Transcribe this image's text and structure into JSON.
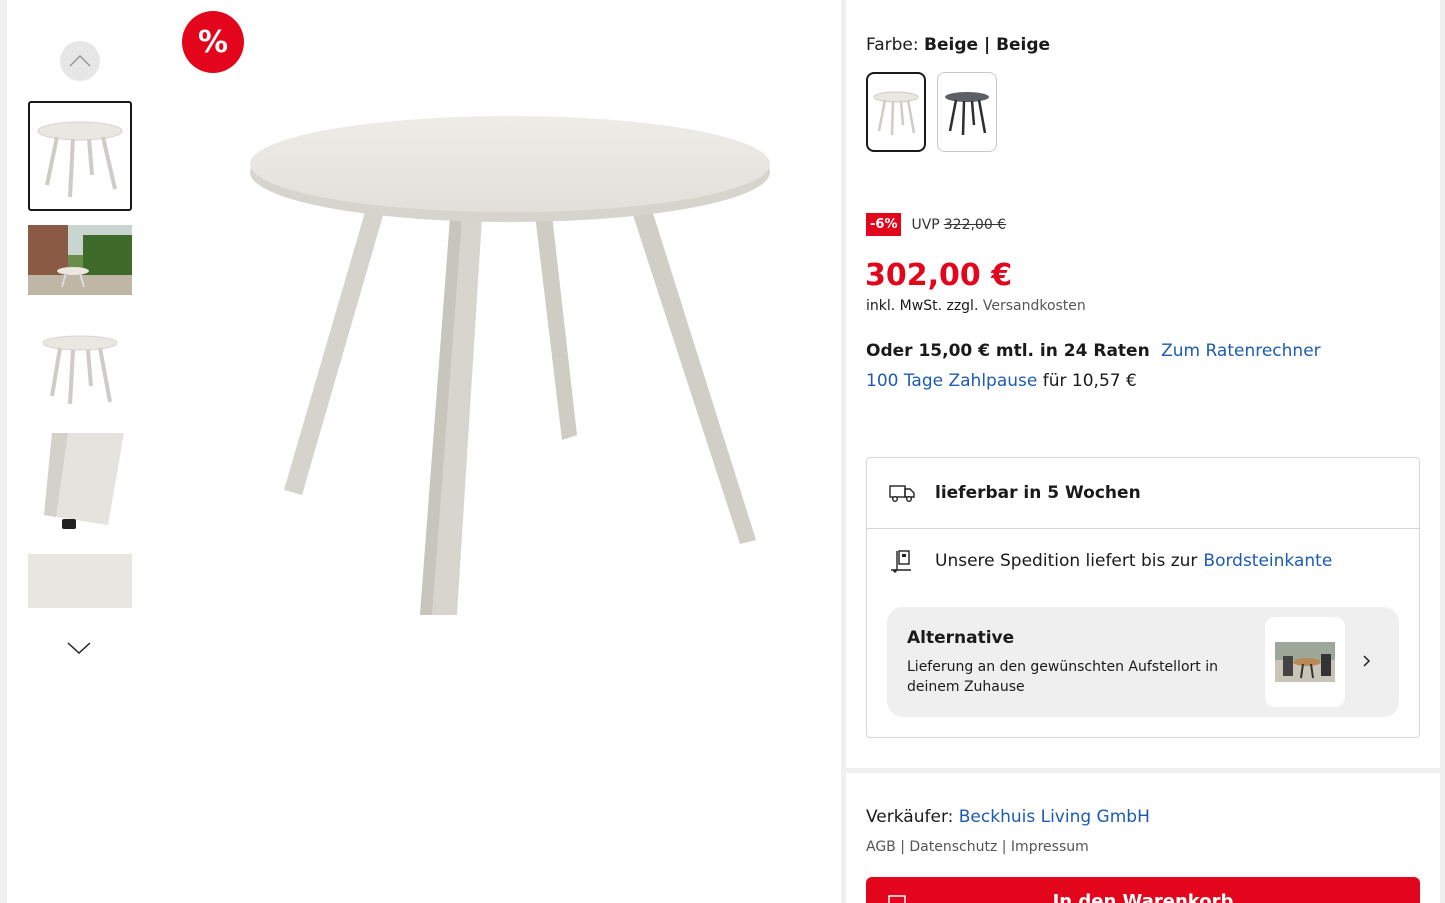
{
  "gallery": {
    "sale_badge": "%",
    "thumbnails": [
      "table-beige-thumb",
      "garden-scene-thumb",
      "table-small-thumb",
      "table-leg-detail-thumb",
      "beige-surface-thumb"
    ]
  },
  "product": {
    "color_label": "Farbe:",
    "color_value": "Beige | Beige",
    "swatches": [
      "Beige",
      "Anthrazit"
    ],
    "discount_badge": "-6%",
    "uvp_label": "UVP",
    "uvp_price": "322,00 €",
    "price": "302,00 €",
    "vat_text": "inkl. MwSt. zzgl.",
    "shipping_link": "Versandkosten",
    "installment_text": "Oder 15,00 € mtl. in 24 Raten",
    "installment_link": "Zum Ratenrechner",
    "pause_link": "100 Tage Zahlpause",
    "pause_text": "für 10,57 €"
  },
  "delivery": {
    "availability": "lieferbar in 5 Wochen",
    "shipping_text": "Unsere Spedition liefert bis zur",
    "shipping_link": "Bordsteinkante",
    "alternative_title": "Alternative",
    "alternative_desc": "Lieferung an den gewünschten Aufstellort in deinem Zuhause"
  },
  "seller": {
    "label": "Verkäufer:",
    "name": "Beckhuis Living GmbH",
    "legal_links": "AGB | Datenschutz | Impressum",
    "cart_button": "In den Warenkorb"
  },
  "colors": {
    "accent_red": "#e3051b",
    "link_blue": "#1d5bb3"
  }
}
